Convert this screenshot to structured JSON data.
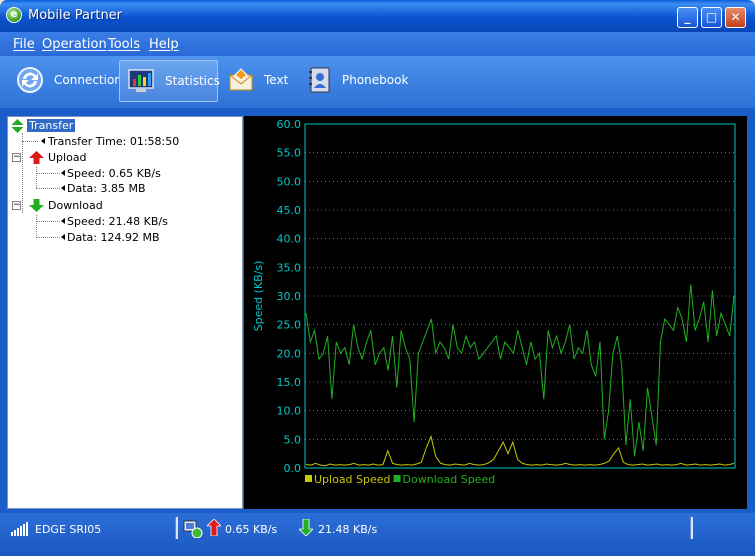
{
  "window": {
    "title": "Mobile Partner",
    "app_icon": "mobile-partner-logo-icon"
  },
  "menu": [
    {
      "label": "File"
    },
    {
      "label": "Operation"
    },
    {
      "label": "Tools"
    },
    {
      "label": "Help"
    }
  ],
  "toolbar": [
    {
      "label": "Connection",
      "icon": "connection-icon"
    },
    {
      "label": "Statistics",
      "icon": "statistics-icon",
      "active": true
    },
    {
      "label": "Text",
      "icon": "text-message-icon"
    },
    {
      "label": "Phonebook",
      "icon": "phonebook-icon"
    }
  ],
  "tree": {
    "transfer": "Transfer",
    "transfer_time": "Transfer Time: 01:58:50",
    "upload": "Upload",
    "upload_speed": "Speed: 0.65 KB/s",
    "upload_data": "Data: 3.85 MB",
    "download": "Download",
    "download_speed": "Speed: 21.48 KB/s",
    "download_data": "Data: 124.92 MB"
  },
  "status": {
    "network": "EDGE  SRI05",
    "upload_speed": "0.65 KB/s",
    "download_speed": "21.48 KB/s"
  },
  "colors": {
    "chart_bg": "#000000",
    "axis": "#00c8c8",
    "upload": "#c8c800",
    "download": "#20b020"
  },
  "chart_data": {
    "type": "line",
    "ylabel": "Speed (KB/s)",
    "ylim": [
      0,
      60
    ],
    "yticks": [
      "0.0",
      "5.0",
      "10.0",
      "15.0",
      "20.0",
      "25.0",
      "30.0",
      "35.0",
      "40.0",
      "45.0",
      "50.0",
      "55.0",
      "60.0"
    ],
    "grid": true,
    "legend_position": "bottom",
    "series": [
      {
        "name": "Upload Speed",
        "color": "#c8c800",
        "values": [
          0.6,
          0.5,
          0.8,
          0.5,
          0.4,
          0.7,
          0.5,
          0.6,
          0.5,
          0.6,
          0.8,
          0.5,
          0.6,
          0.5,
          0.7,
          0.5,
          0.6,
          3.0,
          0.8,
          0.6,
          0.5,
          0.6,
          0.5,
          0.7,
          1.0,
          3.5,
          5.5,
          2.0,
          0.8,
          0.6,
          0.5,
          0.7,
          0.6,
          0.5,
          0.8,
          0.6,
          0.5,
          0.6,
          0.9,
          1.5,
          3.0,
          4.5,
          2.5,
          4.5,
          1.5,
          0.8,
          0.6,
          0.5,
          0.6,
          0.5,
          0.7,
          0.6,
          0.5,
          0.6,
          0.8,
          0.6,
          0.5,
          0.6,
          0.5,
          0.6,
          0.5,
          0.6,
          0.8,
          1.2,
          2.5,
          3.5,
          1.0,
          0.6,
          0.5,
          0.6,
          0.7,
          0.5,
          0.6,
          0.7,
          0.5,
          0.6,
          0.5,
          0.6,
          0.8,
          0.5,
          0.6,
          0.7,
          0.5,
          0.6,
          0.5,
          0.6,
          0.7,
          0.5,
          0.6,
          0.8
        ]
      },
      {
        "name": "Download Speed",
        "color": "#20b020",
        "values": [
          27,
          22,
          24,
          19,
          20,
          23,
          12,
          22,
          20,
          21,
          18,
          25,
          21,
          19,
          22,
          24,
          18,
          20,
          21,
          17,
          23,
          14,
          24,
          21,
          19,
          8,
          20,
          22,
          24,
          26,
          20,
          22,
          21,
          19,
          25,
          21,
          20,
          23,
          21,
          22,
          19,
          20,
          21,
          22,
          23,
          19,
          22,
          21,
          20,
          24,
          21,
          18,
          22,
          19,
          20,
          12,
          24,
          21,
          23,
          20,
          22,
          25,
          19,
          21,
          20,
          24,
          18,
          16,
          22,
          5,
          10,
          20,
          23,
          18,
          4,
          12,
          2,
          8,
          3,
          14,
          9,
          4,
          22,
          26,
          25,
          24,
          28,
          26,
          22,
          32,
          24,
          26,
          29,
          22,
          31,
          23,
          27,
          25,
          23,
          30
        ]
      }
    ]
  }
}
